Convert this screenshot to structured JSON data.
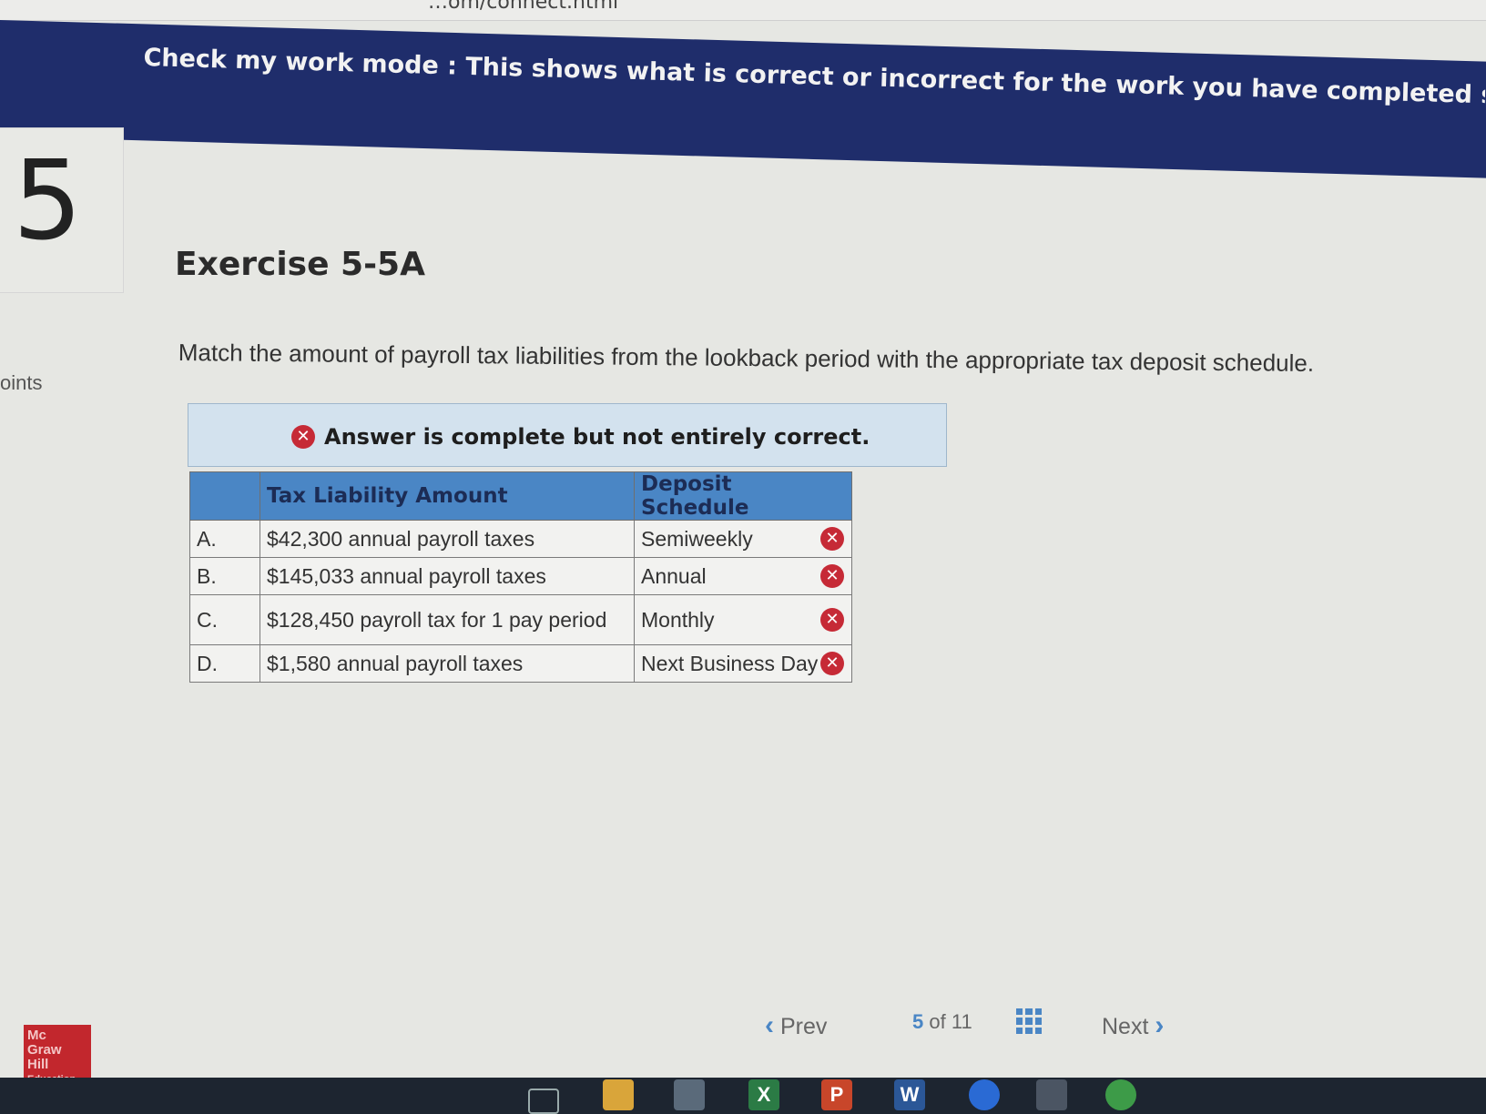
{
  "browser": {
    "url_fragment": "…om/connect.html"
  },
  "banner": {
    "text": "Check my work mode : This shows what is correct or incorrect for the work you have completed so far. It does not"
  },
  "question": {
    "number": "5",
    "points_label": "oints",
    "title": "Exercise 5-5A",
    "instructions": "Match the amount of payroll tax liabilities from the lookback period with the appropriate tax deposit schedule."
  },
  "result": {
    "message": "Answer is complete but not entirely correct.",
    "icon": "x-circle-icon"
  },
  "table": {
    "headers": [
      "",
      "Tax Liability Amount",
      "Deposit Schedule"
    ],
    "rows": [
      {
        "letter": "A.",
        "amount": "$42,300 annual payroll taxes",
        "schedule": "Semiweekly",
        "status": "incorrect"
      },
      {
        "letter": "B.",
        "amount": "$145,033 annual payroll taxes",
        "schedule": "Annual",
        "status": "incorrect"
      },
      {
        "letter": "C.",
        "amount": "$128,450 payroll tax for 1 pay period",
        "schedule": "Monthly",
        "status": "incorrect"
      },
      {
        "letter": "D.",
        "amount": "$1,580 annual payroll taxes",
        "schedule": "Next Business Day",
        "status": "incorrect"
      }
    ]
  },
  "nav": {
    "prev_label": "Prev",
    "current": "5",
    "of_label": "of",
    "total": "11",
    "next_label": "Next"
  },
  "logo": {
    "line1": "Mc",
    "line2": "Graw",
    "line3": "Hill",
    "line4": "Education"
  },
  "taskbar": {
    "excel": "X",
    "powerpoint": "P",
    "word": "W"
  },
  "colors": {
    "banner": "#1f2d6b",
    "header_blue": "#4a86c5",
    "error_red": "#c62a36",
    "result_bg": "#d3e2ee"
  }
}
